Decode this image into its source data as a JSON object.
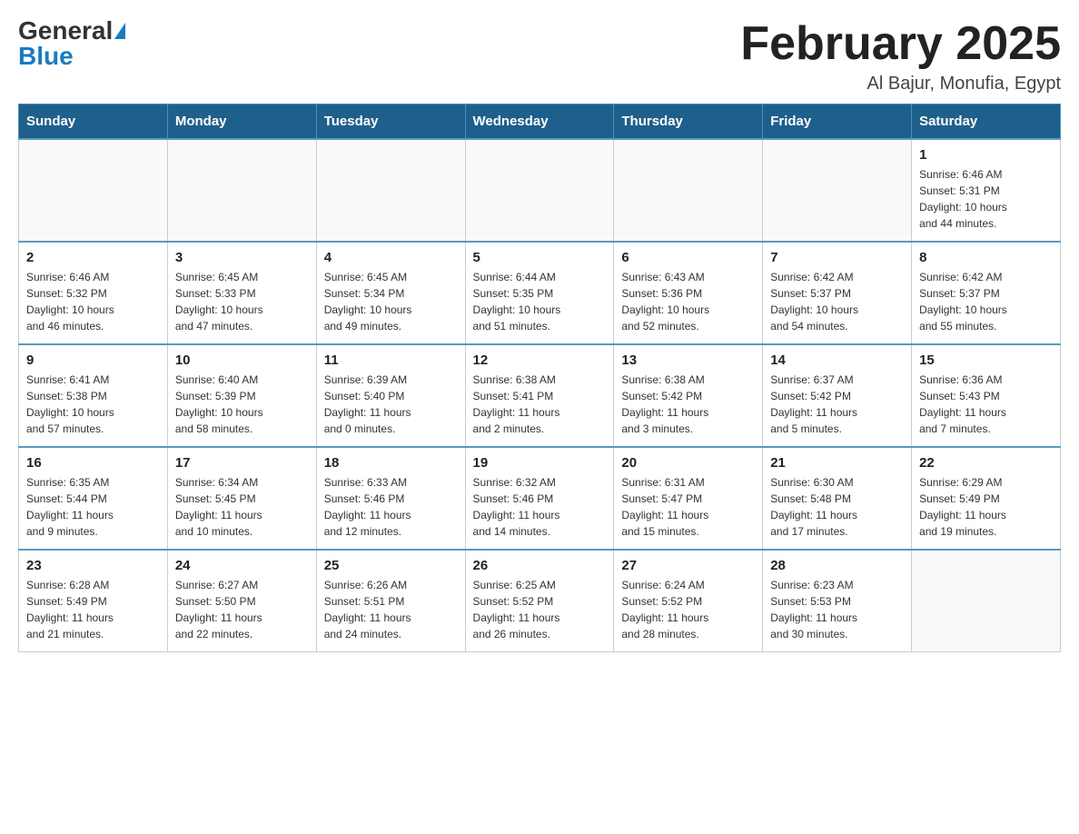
{
  "header": {
    "logo_general": "General",
    "logo_blue": "Blue",
    "title": "February 2025",
    "subtitle": "Al Bajur, Monufia, Egypt"
  },
  "days_of_week": [
    "Sunday",
    "Monday",
    "Tuesday",
    "Wednesday",
    "Thursday",
    "Friday",
    "Saturday"
  ],
  "weeks": [
    [
      {
        "day": "",
        "info": ""
      },
      {
        "day": "",
        "info": ""
      },
      {
        "day": "",
        "info": ""
      },
      {
        "day": "",
        "info": ""
      },
      {
        "day": "",
        "info": ""
      },
      {
        "day": "",
        "info": ""
      },
      {
        "day": "1",
        "info": "Sunrise: 6:46 AM\nSunset: 5:31 PM\nDaylight: 10 hours\nand 44 minutes."
      }
    ],
    [
      {
        "day": "2",
        "info": "Sunrise: 6:46 AM\nSunset: 5:32 PM\nDaylight: 10 hours\nand 46 minutes."
      },
      {
        "day": "3",
        "info": "Sunrise: 6:45 AM\nSunset: 5:33 PM\nDaylight: 10 hours\nand 47 minutes."
      },
      {
        "day": "4",
        "info": "Sunrise: 6:45 AM\nSunset: 5:34 PM\nDaylight: 10 hours\nand 49 minutes."
      },
      {
        "day": "5",
        "info": "Sunrise: 6:44 AM\nSunset: 5:35 PM\nDaylight: 10 hours\nand 51 minutes."
      },
      {
        "day": "6",
        "info": "Sunrise: 6:43 AM\nSunset: 5:36 PM\nDaylight: 10 hours\nand 52 minutes."
      },
      {
        "day": "7",
        "info": "Sunrise: 6:42 AM\nSunset: 5:37 PM\nDaylight: 10 hours\nand 54 minutes."
      },
      {
        "day": "8",
        "info": "Sunrise: 6:42 AM\nSunset: 5:37 PM\nDaylight: 10 hours\nand 55 minutes."
      }
    ],
    [
      {
        "day": "9",
        "info": "Sunrise: 6:41 AM\nSunset: 5:38 PM\nDaylight: 10 hours\nand 57 minutes."
      },
      {
        "day": "10",
        "info": "Sunrise: 6:40 AM\nSunset: 5:39 PM\nDaylight: 10 hours\nand 58 minutes."
      },
      {
        "day": "11",
        "info": "Sunrise: 6:39 AM\nSunset: 5:40 PM\nDaylight: 11 hours\nand 0 minutes."
      },
      {
        "day": "12",
        "info": "Sunrise: 6:38 AM\nSunset: 5:41 PM\nDaylight: 11 hours\nand 2 minutes."
      },
      {
        "day": "13",
        "info": "Sunrise: 6:38 AM\nSunset: 5:42 PM\nDaylight: 11 hours\nand 3 minutes."
      },
      {
        "day": "14",
        "info": "Sunrise: 6:37 AM\nSunset: 5:42 PM\nDaylight: 11 hours\nand 5 minutes."
      },
      {
        "day": "15",
        "info": "Sunrise: 6:36 AM\nSunset: 5:43 PM\nDaylight: 11 hours\nand 7 minutes."
      }
    ],
    [
      {
        "day": "16",
        "info": "Sunrise: 6:35 AM\nSunset: 5:44 PM\nDaylight: 11 hours\nand 9 minutes."
      },
      {
        "day": "17",
        "info": "Sunrise: 6:34 AM\nSunset: 5:45 PM\nDaylight: 11 hours\nand 10 minutes."
      },
      {
        "day": "18",
        "info": "Sunrise: 6:33 AM\nSunset: 5:46 PM\nDaylight: 11 hours\nand 12 minutes."
      },
      {
        "day": "19",
        "info": "Sunrise: 6:32 AM\nSunset: 5:46 PM\nDaylight: 11 hours\nand 14 minutes."
      },
      {
        "day": "20",
        "info": "Sunrise: 6:31 AM\nSunset: 5:47 PM\nDaylight: 11 hours\nand 15 minutes."
      },
      {
        "day": "21",
        "info": "Sunrise: 6:30 AM\nSunset: 5:48 PM\nDaylight: 11 hours\nand 17 minutes."
      },
      {
        "day": "22",
        "info": "Sunrise: 6:29 AM\nSunset: 5:49 PM\nDaylight: 11 hours\nand 19 minutes."
      }
    ],
    [
      {
        "day": "23",
        "info": "Sunrise: 6:28 AM\nSunset: 5:49 PM\nDaylight: 11 hours\nand 21 minutes."
      },
      {
        "day": "24",
        "info": "Sunrise: 6:27 AM\nSunset: 5:50 PM\nDaylight: 11 hours\nand 22 minutes."
      },
      {
        "day": "25",
        "info": "Sunrise: 6:26 AM\nSunset: 5:51 PM\nDaylight: 11 hours\nand 24 minutes."
      },
      {
        "day": "26",
        "info": "Sunrise: 6:25 AM\nSunset: 5:52 PM\nDaylight: 11 hours\nand 26 minutes."
      },
      {
        "day": "27",
        "info": "Sunrise: 6:24 AM\nSunset: 5:52 PM\nDaylight: 11 hours\nand 28 minutes."
      },
      {
        "day": "28",
        "info": "Sunrise: 6:23 AM\nSunset: 5:53 PM\nDaylight: 11 hours\nand 30 minutes."
      },
      {
        "day": "",
        "info": ""
      }
    ]
  ]
}
